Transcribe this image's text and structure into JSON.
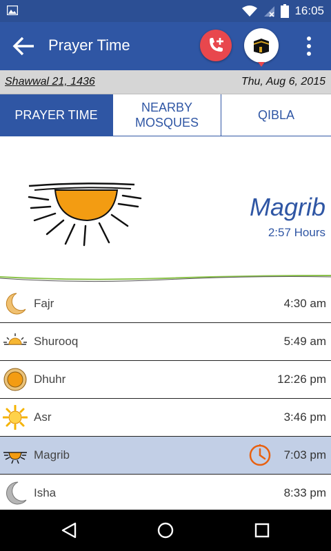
{
  "status_bar": {
    "time": "16:05",
    "icons": [
      "image-icon",
      "wifi-icon",
      "no-sim-icon",
      "battery-icon"
    ]
  },
  "app_bar": {
    "title": "Prayer Time",
    "icons": [
      "back-arrow-icon",
      "add-call-icon",
      "kaaba-icon",
      "more-vert-icon"
    ]
  },
  "date_bar": {
    "hijri": "Shawwal 21, 1436",
    "gregorian": "Thu, Aug 6, 2015"
  },
  "tabs": [
    {
      "label": "PRAYER TIME",
      "active": true
    },
    {
      "label": "NEARBY\nMOSQUES",
      "active": false
    },
    {
      "label": "QIBLA",
      "active": false
    }
  ],
  "next_prayer": {
    "name": "Magrib",
    "remaining": "2:57 Hours"
  },
  "prayers": [
    {
      "name": "Fajr",
      "time": "4:30 am",
      "icon": "crescent-icon"
    },
    {
      "name": "Shurooq",
      "time": "5:49 am",
      "icon": "sunrise-icon"
    },
    {
      "name": "Dhuhr",
      "time": "12:26 pm",
      "icon": "sun-icon"
    },
    {
      "name": "Asr",
      "time": "3:46 pm",
      "icon": "bright-sun-icon"
    },
    {
      "name": "Magrib",
      "time": "7:03 pm",
      "icon": "sunset-icon",
      "current": true
    },
    {
      "name": "Isha",
      "time": "8:33 pm",
      "icon": "grey-crescent-icon"
    }
  ],
  "colors": {
    "primary": "#2f56a4",
    "accent_red": "#e8474d",
    "current_row": "#c2cfe6",
    "sun_orange": "#f39c12"
  },
  "nav_bar": {
    "icons": [
      "back-triangle-icon",
      "home-circle-icon",
      "recents-square-icon"
    ]
  }
}
